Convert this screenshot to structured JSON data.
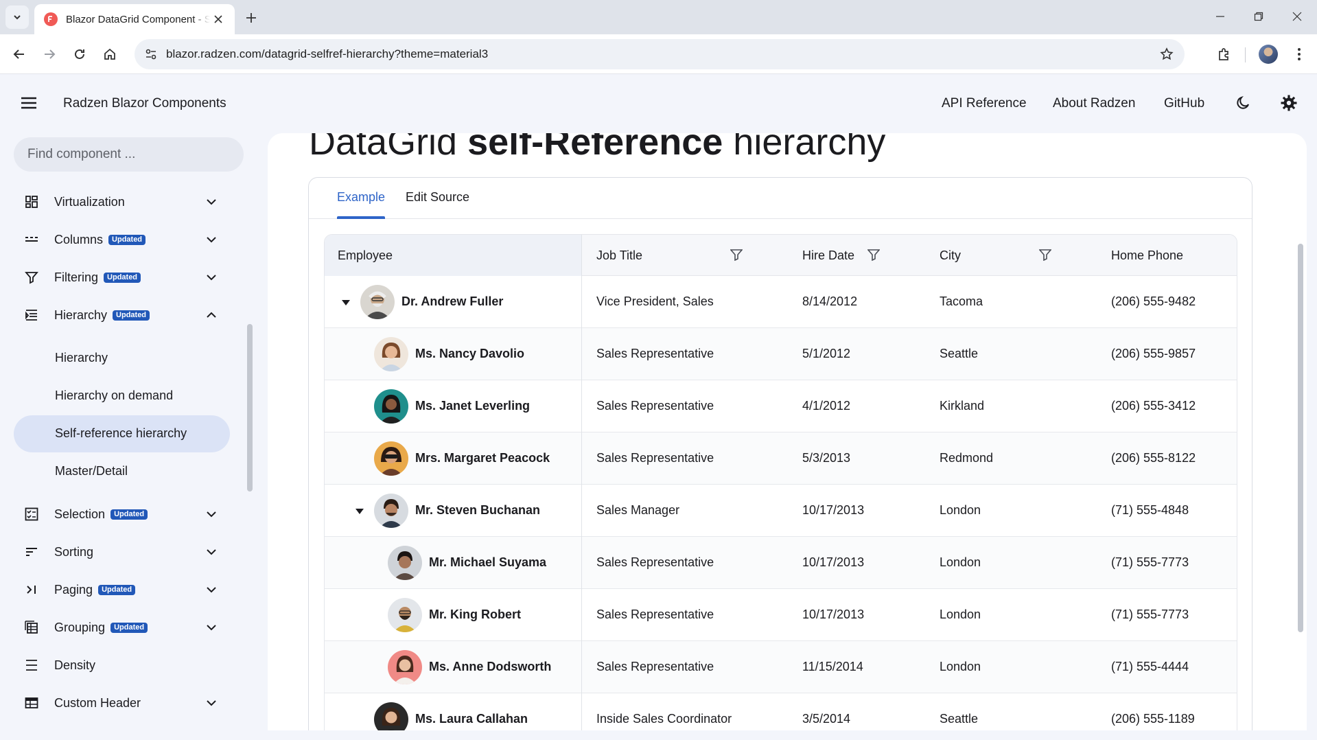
{
  "browser": {
    "tab_title": "Blazor DataGrid Component - Self-reference hierarchy",
    "url": "blazor.radzen.com/datagrid-selfref-hierarchy?theme=material3",
    "favicon_color": "#f05a56"
  },
  "header": {
    "title": "Radzen Blazor Components",
    "links": [
      "API Reference",
      "About Radzen",
      "GitHub"
    ],
    "icons": [
      "theme-toggle-icon",
      "settings-icon"
    ]
  },
  "sidebar": {
    "search_placeholder": "Find component ...",
    "badge_text": "Updated",
    "badge_color": "#2158b8",
    "items": [
      {
        "label": "Virtualization",
        "icon": "virtualization-icon",
        "updated": false
      },
      {
        "label": "Columns",
        "icon": "columns-icon",
        "updated": true
      },
      {
        "label": "Filtering",
        "icon": "filter-icon",
        "updated": true
      },
      {
        "label": "Hierarchy",
        "icon": "hierarchy-icon",
        "updated": true,
        "expanded": true
      },
      {
        "label": "Selection",
        "icon": "selection-icon",
        "updated": true
      },
      {
        "label": "Sorting",
        "icon": "sort-icon",
        "updated": false
      },
      {
        "label": "Paging",
        "icon": "paging-icon",
        "updated": true
      },
      {
        "label": "Grouping",
        "icon": "grouping-icon",
        "updated": true
      },
      {
        "label": "Density",
        "icon": "density-icon",
        "updated": false
      },
      {
        "label": "Custom Header",
        "icon": "custom-header-icon",
        "updated": false
      }
    ],
    "sub_items": [
      "Hierarchy",
      "Hierarchy on demand",
      "Self-reference hierarchy",
      "Master/Detail"
    ],
    "active_sub_item": "Self-reference hierarchy"
  },
  "page": {
    "heading_pre": "DataGrid ",
    "heading_bold": "self-Reference",
    "heading_post": " hierarchy",
    "tabs": [
      "Example",
      "Edit Source"
    ],
    "active_tab": "Example",
    "accent": "#2e64c8"
  },
  "grid": {
    "columns": [
      "Employee",
      "Job Title",
      "Hire Date",
      "City",
      "Home Phone"
    ],
    "rows": [
      {
        "name": "Dr. Andrew Fuller",
        "job": "Vice President, Sales",
        "hire": "8/14/2012",
        "city": "Tacoma",
        "phone": "(206) 555-9482",
        "level": 0,
        "expanded": true
      },
      {
        "name": "Ms. Nancy Davolio",
        "job": "Sales Representative",
        "hire": "5/1/2012",
        "city": "Seattle",
        "phone": "(206) 555-9857",
        "level": 1,
        "expanded": false
      },
      {
        "name": "Ms. Janet Leverling",
        "job": "Sales Representative",
        "hire": "4/1/2012",
        "city": "Kirkland",
        "phone": "(206) 555-3412",
        "level": 1,
        "expanded": false
      },
      {
        "name": "Mrs. Margaret Peacock",
        "job": "Sales Representative",
        "hire": "5/3/2013",
        "city": "Redmond",
        "phone": "(206) 555-8122",
        "level": 1,
        "expanded": false
      },
      {
        "name": "Mr. Steven Buchanan",
        "job": "Sales Manager",
        "hire": "10/17/2013",
        "city": "London",
        "phone": "(71) 555-4848",
        "level": 1,
        "expanded": true
      },
      {
        "name": "Mr. Michael Suyama",
        "job": "Sales Representative",
        "hire": "10/17/2013",
        "city": "London",
        "phone": "(71) 555-7773",
        "level": 2,
        "expanded": false
      },
      {
        "name": "Mr. King Robert",
        "job": "Sales Representative",
        "hire": "10/17/2013",
        "city": "London",
        "phone": "(71) 555-7773",
        "level": 2,
        "expanded": false
      },
      {
        "name": "Ms. Anne Dodsworth",
        "job": "Sales Representative",
        "hire": "11/15/2014",
        "city": "London",
        "phone": "(71) 555-4444",
        "level": 2,
        "expanded": false
      },
      {
        "name": "Ms. Laura Callahan",
        "job": "Inside Sales Coordinator",
        "hire": "3/5/2014",
        "city": "Seattle",
        "phone": "(206) 555-1189",
        "level": 1,
        "expanded": false
      }
    ]
  }
}
